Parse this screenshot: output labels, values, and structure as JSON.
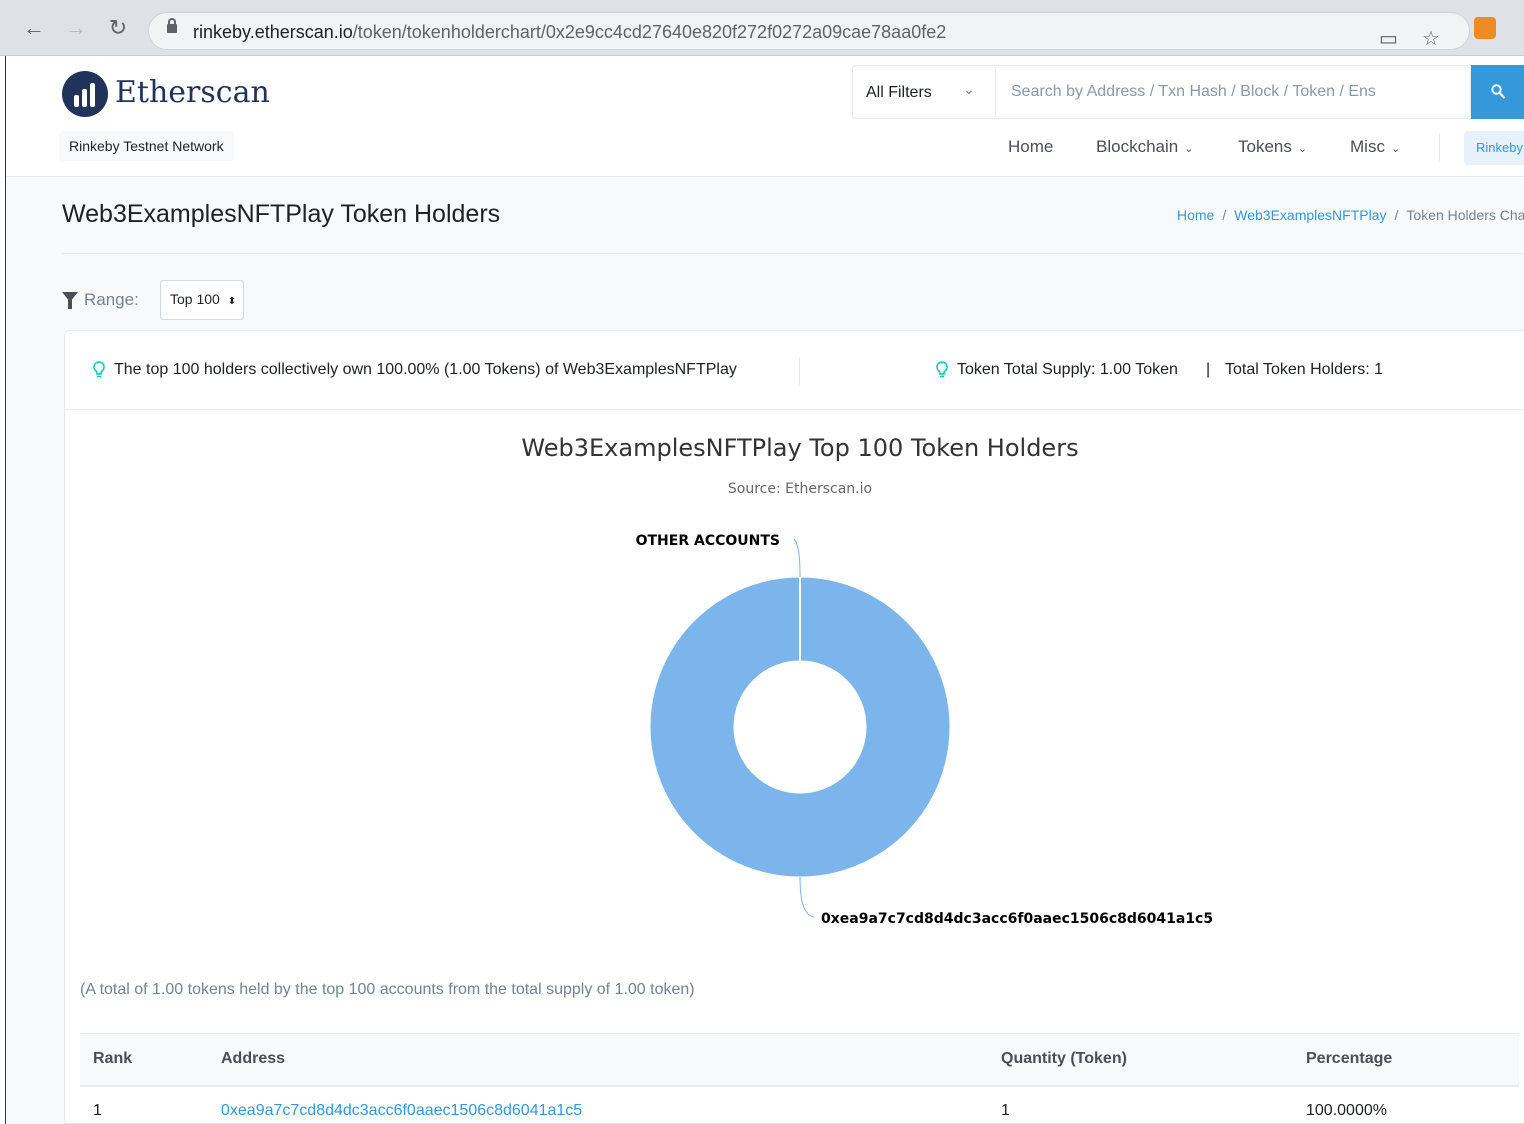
{
  "browser": {
    "url_host": "rinkeby.etherscan.io",
    "url_path": "/token/tokenholderchart/0x2e9cc4cd27640e820f272f0272a09cae78aa0fe2"
  },
  "header": {
    "logo_text": "Etherscan",
    "network_badge": "Rinkeby Testnet Network",
    "filter_label": "All Filters",
    "search_placeholder": "Search by Address / Txn Hash / Block / Token / Ens",
    "nav": [
      {
        "label": "Home"
      },
      {
        "label": "Blockchain"
      },
      {
        "label": "Tokens"
      },
      {
        "label": "Misc"
      }
    ],
    "network_pill": "Rinkeby"
  },
  "page": {
    "title": "Web3ExamplesNFTPlay Token Holders",
    "breadcrumb": [
      "Home",
      "Web3ExamplesNFTPlay",
      "Token Holders Chart"
    ],
    "range_label": "Range:",
    "range_value": "Top 100"
  },
  "info": {
    "collective": "The top 100 holders collectively own 100.00% (1.00 Tokens) of Web3ExamplesNFTPlay",
    "supply": "Token Total Supply: 1.00 Token",
    "separator": "|",
    "holders": "Total Token Holders: 1"
  },
  "chart_data": {
    "type": "pie",
    "title": "Web3ExamplesNFTPlay Top 100 Token Holders",
    "subtitle": "Source: Etherscan.io",
    "categories": [
      "0xea9a7c7cd8d4dc3acc6f0aaec1506c8d6041a1c5",
      "OTHER ACCOUNTS"
    ],
    "values": [
      100,
      0
    ],
    "colors": [
      "#7cb5ec",
      "#434348"
    ],
    "donut": true
  },
  "summary_note": "(A total of 1.00 tokens held by the top 100 accounts from the total supply of 1.00 token)",
  "table": {
    "headers": [
      "Rank",
      "Address",
      "Quantity (Token)",
      "Percentage"
    ],
    "rows": [
      {
        "rank": "1",
        "address": "0xea9a7c7cd8d4dc3acc6f0aaec1506c8d6041a1c5",
        "quantity": "1",
        "percentage": "100.0000%"
      }
    ]
  }
}
